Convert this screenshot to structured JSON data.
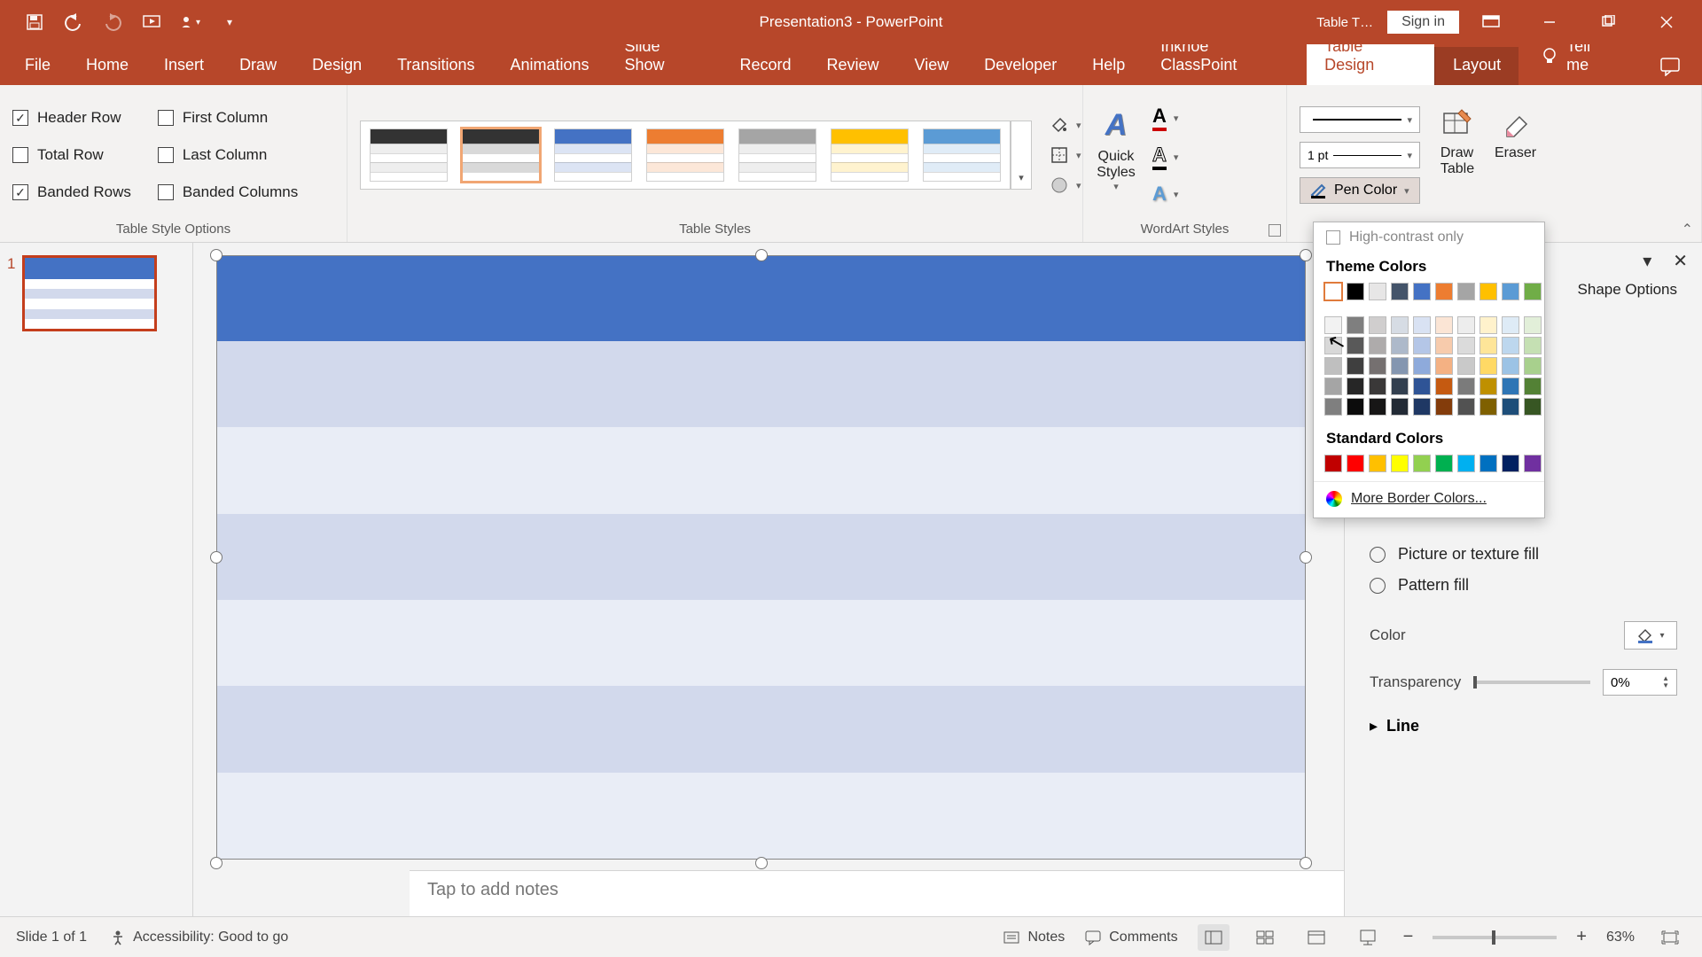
{
  "title": "Presentation3  -  PowerPoint",
  "title_right": {
    "table_tools": "Table T…",
    "sign_in": "Sign in"
  },
  "tabs": [
    "File",
    "Home",
    "Insert",
    "Draw",
    "Design",
    "Transitions",
    "Animations",
    "Slide Show",
    "Record",
    "Review",
    "View",
    "Developer",
    "Help",
    "Inknoe ClassPoint",
    "Table Design",
    "Layout"
  ],
  "tellme": "Tell me",
  "groups": {
    "tso": {
      "label": "Table Style Options",
      "items": {
        "header_row": "Header Row",
        "total_row": "Total Row",
        "banded_rows": "Banded Rows",
        "first_column": "First Column",
        "last_column": "Last Column",
        "banded_columns": "Banded Columns"
      },
      "checked": {
        "header_row": true,
        "total_row": false,
        "banded_rows": true,
        "first_column": false,
        "last_column": false,
        "banded_columns": false
      }
    },
    "styles": {
      "label": "Table Styles"
    },
    "wordart": {
      "label": "WordArt Styles",
      "quick_styles": "Quick\nStyles"
    },
    "borders": {
      "label": "Draw Borders",
      "pen_weight": "1 pt",
      "pen_color": "Pen Color",
      "draw_table": "Draw\nTable",
      "eraser": "Eraser"
    }
  },
  "gallery_colors": [
    "#333333",
    "#4472c4",
    "#ed7d31",
    "#a5a5a5",
    "#ffc000",
    "#5b9bd5"
  ],
  "color_popup": {
    "high_contrast": "High-contrast only",
    "theme_title": "Theme Colors",
    "theme_row": [
      "#ffffff",
      "#000000",
      "#e7e6e6",
      "#44546a",
      "#4472c4",
      "#ed7d31",
      "#a5a5a5",
      "#ffc000",
      "#5b9bd5",
      "#70ad47"
    ],
    "theme_tints": [
      [
        "#f2f2f2",
        "#7f7f7f",
        "#d0cece",
        "#d6dce4",
        "#d9e2f3",
        "#fbe5d5",
        "#ededed",
        "#fff2cc",
        "#deebf6",
        "#e2efd9"
      ],
      [
        "#d8d8d8",
        "#595959",
        "#aeabab",
        "#adb9ca",
        "#b4c6e7",
        "#f7cbac",
        "#dbdbdb",
        "#fee599",
        "#bdd7ee",
        "#c5e0b3"
      ],
      [
        "#bfbfbf",
        "#3f3f3f",
        "#757070",
        "#8496b0",
        "#8eaadb",
        "#f4b183",
        "#c9c9c9",
        "#ffd965",
        "#9cc3e5",
        "#a8d08d"
      ],
      [
        "#a5a5a5",
        "#262626",
        "#3a3838",
        "#323f4f",
        "#2f5496",
        "#c55a11",
        "#7b7b7b",
        "#bf9000",
        "#2e75b5",
        "#538135"
      ],
      [
        "#7f7f7f",
        "#0c0c0c",
        "#171616",
        "#222a35",
        "#1f3864",
        "#833c0b",
        "#525252",
        "#7f6000",
        "#1e4e79",
        "#375623"
      ]
    ],
    "standard_title": "Standard Colors",
    "standard": [
      "#c00000",
      "#ff0000",
      "#ffc000",
      "#ffff00",
      "#92d050",
      "#00b050",
      "#00b0f0",
      "#0070c0",
      "#002060",
      "#7030a0"
    ],
    "more": "More Border Colors..."
  },
  "format_pane": {
    "shape_options": "Shape Options",
    "picture_fill": "Picture or texture fill",
    "pattern_fill": "Pattern fill",
    "color": "Color",
    "transparency": "Transparency",
    "transparency_val": "0%",
    "line": "Line"
  },
  "notes_placeholder": "Tap to add notes",
  "status": {
    "slide": "Slide 1 of 1",
    "accessibility": "Accessibility: Good to go",
    "notes": "Notes",
    "comments": "Comments",
    "zoom": "63%"
  },
  "slide_number": "1"
}
